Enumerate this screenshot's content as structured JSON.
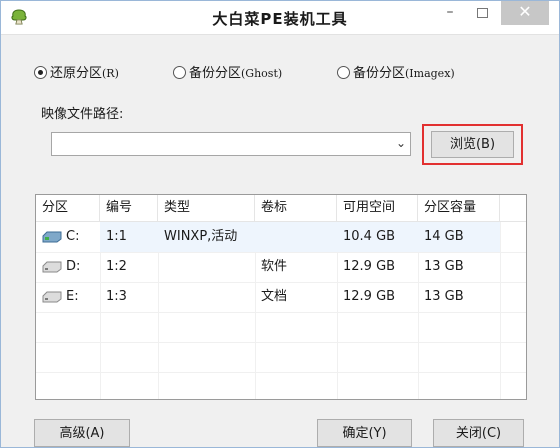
{
  "window": {
    "title": "大白菜PE装机工具",
    "minimize_glyph": "–",
    "close_glyph": "✕",
    "icon": "cabbage-app-icon"
  },
  "mode": {
    "options": [
      {
        "label": "还原分区",
        "accel": "(R)",
        "selected": true
      },
      {
        "label": "备份分区",
        "accel": "(Ghost)",
        "selected": false
      },
      {
        "label": "备份分区",
        "accel": "(Imagex)",
        "selected": false
      }
    ]
  },
  "image_path": {
    "label": "映像文件路径:",
    "value": "",
    "dropdown_glyph": "⌄",
    "browse_label": "浏览(B)"
  },
  "table": {
    "columns": [
      "分区",
      "编号",
      "类型",
      "卷标",
      "可用空间",
      "分区容量"
    ],
    "rows": [
      {
        "partition": "C:",
        "number": "1:1",
        "type": "WINXP,活动",
        "label": "",
        "free": "10.4 GB",
        "capacity": "14 GB",
        "icon": "system-drive-icon",
        "selected": true
      },
      {
        "partition": "D:",
        "number": "1:2",
        "type": "",
        "label": "软件",
        "free": "12.9 GB",
        "capacity": "13 GB",
        "icon": "drive-icon",
        "selected": false
      },
      {
        "partition": "E:",
        "number": "1:3",
        "type": "",
        "label": "文档",
        "free": "12.9 GB",
        "capacity": "13 GB",
        "icon": "drive-icon",
        "selected": false
      }
    ]
  },
  "buttons": {
    "advanced": "高级(A)",
    "ok": "确定(Y)",
    "close": "关闭(C)"
  },
  "colors": {
    "highlight_border": "#e23030",
    "title_bar": "#ffffff",
    "window_bg": "#f0f0f0"
  }
}
